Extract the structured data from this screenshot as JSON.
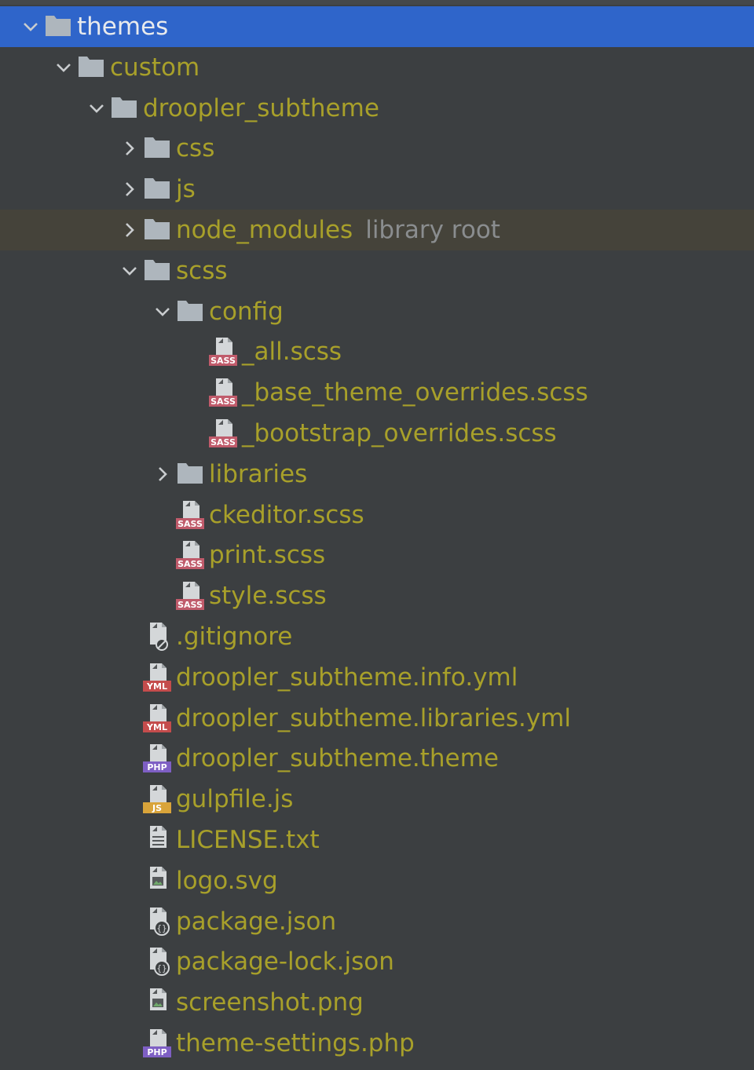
{
  "colors": {
    "background": "#3c3f41",
    "selection": "#2f65ca",
    "highlight_row": "#45433a",
    "file_text": "#a8a02a",
    "selected_text": "#e8eaed",
    "hint_text": "#8a8d8f",
    "folder_icon": "#aeb6bd",
    "sass_badge": "#c05b6b",
    "yml_badge": "#c44c4c",
    "php_badge": "#7e5fc4",
    "js_badge": "#d9a43a"
  },
  "tree": {
    "rows": [
      {
        "label": "themes",
        "icon": "folder-icon",
        "arrow": "chevron-down-icon",
        "selected": true
      },
      {
        "label": "custom",
        "icon": "folder-icon",
        "arrow": "chevron-down-icon"
      },
      {
        "label": "droopler_subtheme",
        "icon": "folder-icon",
        "arrow": "chevron-down-icon"
      },
      {
        "label": "css",
        "icon": "folder-icon",
        "arrow": "chevron-right-icon"
      },
      {
        "label": "js",
        "icon": "folder-icon",
        "arrow": "chevron-right-icon"
      },
      {
        "label": "node_modules",
        "hint": "library root",
        "icon": "folder-icon",
        "arrow": "chevron-right-icon",
        "highlighted": true
      },
      {
        "label": "scss",
        "icon": "folder-icon",
        "arrow": "chevron-down-icon"
      },
      {
        "label": "config",
        "icon": "folder-icon",
        "arrow": "chevron-down-icon"
      },
      {
        "label": "_all.scss",
        "icon": "sass-file-icon",
        "badge": "SASS"
      },
      {
        "label": "_base_theme_overrides.scss",
        "icon": "sass-file-icon",
        "badge": "SASS"
      },
      {
        "label": "_bootstrap_overrides.scss",
        "icon": "sass-file-icon",
        "badge": "SASS"
      },
      {
        "label": "libraries",
        "icon": "folder-icon",
        "arrow": "chevron-right-icon"
      },
      {
        "label": "ckeditor.scss",
        "icon": "sass-file-icon",
        "badge": "SASS"
      },
      {
        "label": "print.scss",
        "icon": "sass-file-icon",
        "badge": "SASS"
      },
      {
        "label": "style.scss",
        "icon": "sass-file-icon",
        "badge": "SASS"
      },
      {
        "label": ".gitignore",
        "icon": "ignore-file-icon"
      },
      {
        "label": "droopler_subtheme.info.yml",
        "icon": "yml-file-icon",
        "badge": "YML"
      },
      {
        "label": "droopler_subtheme.libraries.yml",
        "icon": "yml-file-icon",
        "badge": "YML"
      },
      {
        "label": "droopler_subtheme.theme",
        "icon": "php-file-icon",
        "badge": "PHP"
      },
      {
        "label": "gulpfile.js",
        "icon": "js-file-icon",
        "badge": "JS"
      },
      {
        "label": "LICENSE.txt",
        "icon": "text-file-icon"
      },
      {
        "label": "logo.svg",
        "icon": "image-file-icon"
      },
      {
        "label": "package.json",
        "icon": "json-file-icon"
      },
      {
        "label": "package-lock.json",
        "icon": "json-file-icon"
      },
      {
        "label": "screenshot.png",
        "icon": "image-file-icon"
      },
      {
        "label": "theme-settings.php",
        "icon": "php-file-icon",
        "badge": "PHP"
      }
    ]
  }
}
